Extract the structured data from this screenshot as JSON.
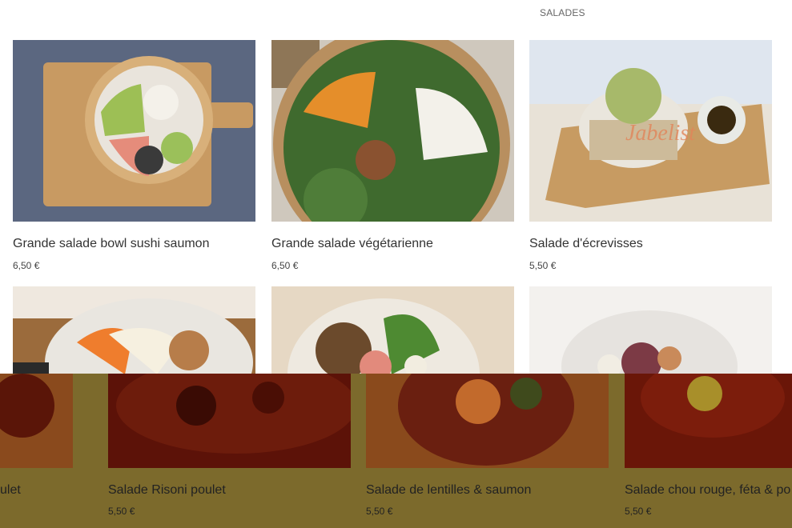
{
  "category": "SALADES",
  "products": [
    {
      "title": "Grande salade bowl sushi saumon",
      "price": "6,50 €"
    },
    {
      "title": "Grande salade végétarienne",
      "price": "6,50 €"
    },
    {
      "title": "Salade d'écrevisses",
      "price": "5,50 €"
    }
  ],
  "row2_images": [
    "salad-photo",
    "salad-photo",
    "salad-photo"
  ],
  "overlay_products": [
    {
      "title": "ulet",
      "price": ""
    },
    {
      "title": "Salade Risoni poulet",
      "price": "5,50 €"
    },
    {
      "title": "Salade de lentilles & saumon",
      "price": "5,50 €"
    },
    {
      "title": "Salade chou rouge, féta & po",
      "price": "5,50 €"
    }
  ],
  "watermark": "Jabelist"
}
